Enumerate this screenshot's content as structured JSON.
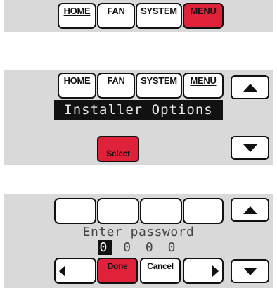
{
  "screen1": {
    "tabs": {
      "home": "HOME",
      "fan": "FAN",
      "system": "SYSTEM",
      "menu": "MENU"
    }
  },
  "screen2": {
    "tabs": {
      "home": "HOME",
      "fan": "FAN",
      "system": "SYSTEM",
      "menu": "MENU"
    },
    "banner": "Installer Options",
    "select_label": "Select",
    "up_icon": "arrow-up-icon",
    "down_icon": "arrow-down-icon"
  },
  "screen3": {
    "prompt": "Enter password",
    "digits": [
      "0",
      "0",
      "0",
      "0"
    ],
    "selected_digit_index": 0,
    "done_label": "Done",
    "cancel_label": "Cancel",
    "left_icon": "arrow-left-icon",
    "right_icon": "arrow-right-icon"
  },
  "colors": {
    "accent_red": "#e0213a",
    "panel_gray": "#d9d9d9",
    "lcd_black": "#111111"
  }
}
